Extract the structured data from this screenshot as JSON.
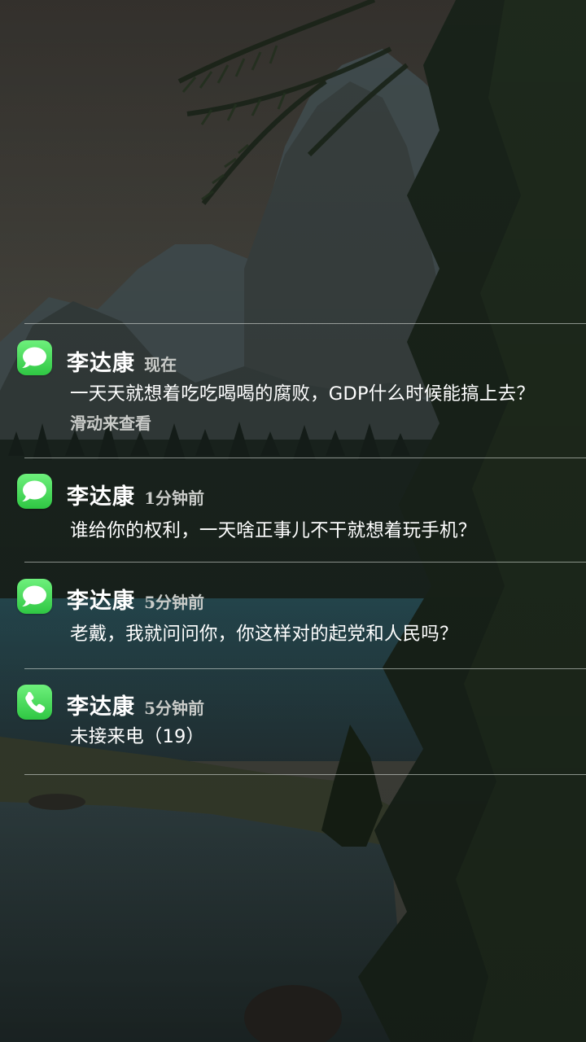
{
  "notifications": [
    {
      "icon": "messages-icon",
      "sender": "李达康",
      "time": "现在",
      "body": "一天天就想着吃吃喝喝的腐败，GDP什么时候能搞上去？",
      "hint": "滑动来查看"
    },
    {
      "icon": "messages-icon",
      "sender": "李达康",
      "time": "1分钟前",
      "body": "谁给你的权利，一天啥正事儿不干就想着玩手机？"
    },
    {
      "icon": "messages-icon",
      "sender": "李达康",
      "time": "5分钟前",
      "body": "老戴，我就问问你，你这样对的起党和人民吗？"
    },
    {
      "icon": "phone-icon",
      "sender": "李达康",
      "time": "5分钟前",
      "body": "未接来电（19）"
    }
  ],
  "colors": {
    "icon_green": "#4cd964",
    "divider": "#e6ebe6",
    "secondary_text": "#c9cbc8"
  }
}
